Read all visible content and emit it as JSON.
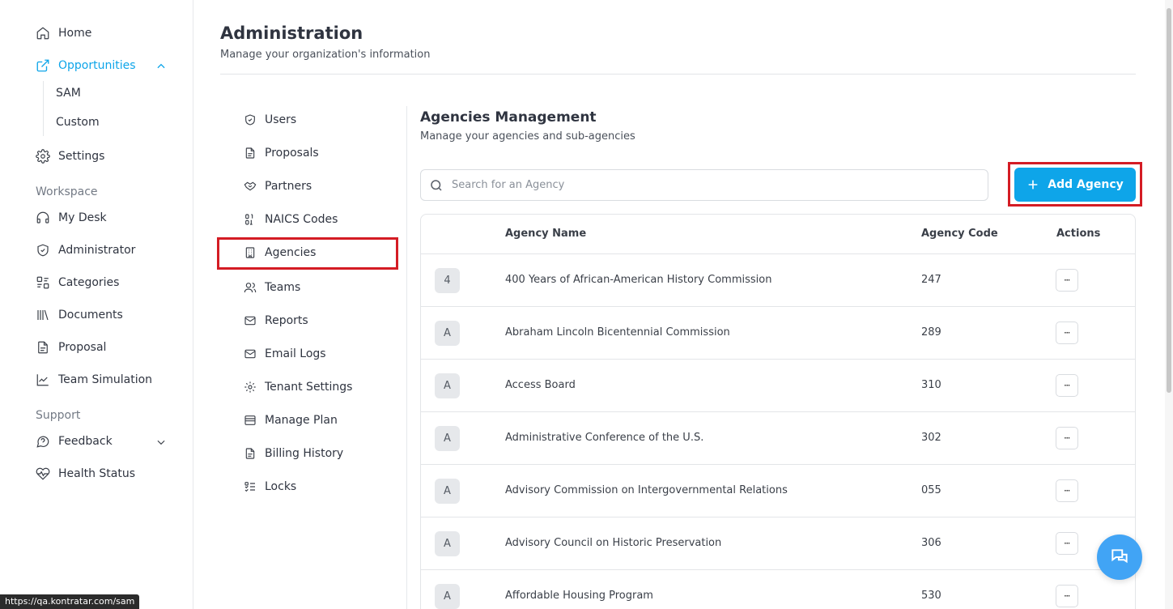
{
  "sidebar": {
    "items": [
      {
        "label": "Home",
        "icon": "home-icon"
      },
      {
        "label": "Opportunities",
        "icon": "external-link-icon"
      },
      {
        "label": "Settings",
        "icon": "gear-icon"
      }
    ],
    "sub_items": [
      "SAM",
      "Custom"
    ],
    "workspace_label": "Workspace",
    "workspace_items": [
      {
        "label": "My Desk",
        "icon": "headset-icon"
      },
      {
        "label": "Administrator",
        "icon": "shield-icon"
      },
      {
        "label": "Categories",
        "icon": "categories-icon"
      },
      {
        "label": "Documents",
        "icon": "library-icon"
      },
      {
        "label": "Proposal",
        "icon": "document-icon"
      },
      {
        "label": "Team Simulation",
        "icon": "line-chart-icon"
      }
    ],
    "support_label": "Support",
    "support_items": [
      {
        "label": "Feedback",
        "icon": "message-icon"
      },
      {
        "label": "Health Status",
        "icon": "heart-pulse-icon"
      }
    ]
  },
  "header": {
    "title": "Administration",
    "subtitle": "Manage your organization's information"
  },
  "admin_menu": [
    {
      "label": "Users",
      "icon": "shield-check-icon"
    },
    {
      "label": "Proposals",
      "icon": "file-icon"
    },
    {
      "label": "Partners",
      "icon": "handshake-icon"
    },
    {
      "label": "NAICS Codes",
      "icon": "binary-icon"
    },
    {
      "label": "Agencies",
      "icon": "building-icon"
    },
    {
      "label": "Teams",
      "icon": "users-icon"
    },
    {
      "label": "Reports",
      "icon": "mail-icon"
    },
    {
      "label": "Email Logs",
      "icon": "mail-icon"
    },
    {
      "label": "Tenant Settings",
      "icon": "gear-icon"
    },
    {
      "label": "Manage Plan",
      "icon": "credit-card-icon"
    },
    {
      "label": "Billing History",
      "icon": "file-icon"
    },
    {
      "label": "Locks",
      "icon": "list-check-icon"
    }
  ],
  "agencies": {
    "title": "Agencies Management",
    "subtitle": "Manage your agencies and sub-agencies",
    "search_placeholder": "Search for an Agency",
    "add_button": "Add Agency",
    "columns": {
      "name": "Agency Name",
      "code": "Agency Code",
      "actions": "Actions"
    },
    "rows": [
      {
        "initial": "4",
        "name": "400 Years of African-American History Commission",
        "code": "247",
        "actions": "···"
      },
      {
        "initial": "A",
        "name": "Abraham Lincoln Bicentennial Commission",
        "code": "289",
        "actions": "···"
      },
      {
        "initial": "A",
        "name": "Access Board",
        "code": "310",
        "actions": "···"
      },
      {
        "initial": "A",
        "name": "Administrative Conference of the U.S.",
        "code": "302",
        "actions": "···"
      },
      {
        "initial": "A",
        "name": "Advisory Commission on Intergovernmental Relations",
        "code": "055",
        "actions": "···"
      },
      {
        "initial": "A",
        "name": "Advisory Council on Historic Preservation",
        "code": "306",
        "actions": "···"
      },
      {
        "initial": "A",
        "name": "Affordable Housing Program",
        "code": "530",
        "actions": "···"
      }
    ]
  },
  "status_url": "https://qa.kontratar.com/sam",
  "colors": {
    "accent": "#0ea5e9",
    "highlight": "#d41c24",
    "chat": "#41a4f5"
  }
}
